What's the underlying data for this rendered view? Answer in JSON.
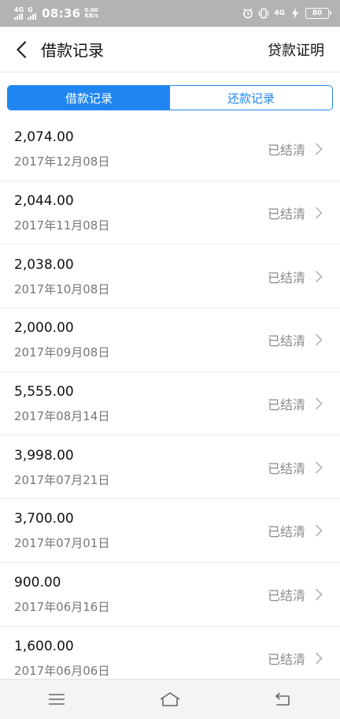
{
  "status_bar": {
    "net1": "4G",
    "net2": "G",
    "time": "08:36",
    "speed_value": "0.00",
    "speed_unit": "KB/s",
    "net3": "4G",
    "battery": "80",
    "icons": [
      "signal-icon",
      "alarm-icon",
      "vibrate-icon",
      "charging-icon",
      "battery-icon"
    ]
  },
  "header": {
    "title": "借款记录",
    "right_link": "贷款证明",
    "back_icon": "chevron-left-icon"
  },
  "tabs": [
    {
      "label": "借款记录",
      "active": true
    },
    {
      "label": "还款记录",
      "active": false
    }
  ],
  "records": [
    {
      "amount": "2,074.00",
      "date": "2017年12月08日",
      "status": "已结清"
    },
    {
      "amount": "2,044.00",
      "date": "2017年11月08日",
      "status": "已结清"
    },
    {
      "amount": "2,038.00",
      "date": "2017年10月08日",
      "status": "已结清"
    },
    {
      "amount": "2,000.00",
      "date": "2017年09月08日",
      "status": "已结清"
    },
    {
      "amount": "5,555.00",
      "date": "2017年08月14日",
      "status": "已结清"
    },
    {
      "amount": "3,998.00",
      "date": "2017年07月21日",
      "status": "已结清"
    },
    {
      "amount": "3,700.00",
      "date": "2017年07月01日",
      "status": "已结清"
    },
    {
      "amount": "900.00",
      "date": "2017年06月16日",
      "status": "已结清"
    },
    {
      "amount": "1,600.00",
      "date": "2017年06月06日",
      "status": "已结清"
    }
  ],
  "bottom_nav": [
    "menu-icon",
    "home-icon",
    "back-icon"
  ],
  "colors": {
    "accent": "#1f86f0",
    "status_bar_bg": "#b3b3b3",
    "status_text": "#8a8a8a",
    "date_text": "#777777",
    "bottom_bar_bg": "#f4f4f4"
  }
}
